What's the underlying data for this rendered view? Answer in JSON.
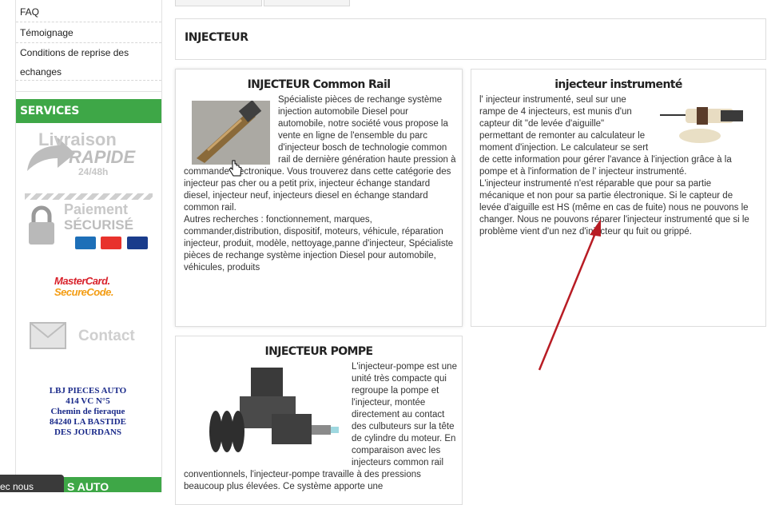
{
  "sidebar": {
    "links": [
      "FAQ",
      "Témoignage",
      "Conditions de reprise des echanges"
    ],
    "services_title": "SERVICES",
    "livraison": {
      "line1": "Livraison",
      "line2": "RAPIDE",
      "line3": "24/48h"
    },
    "paiement": {
      "line1": "Paiement",
      "line2": "SÉCURISÉ"
    },
    "mastercard": {
      "line1": "MasterCard.",
      "line2": "SecureCode."
    },
    "contact_label": "Contact",
    "address": [
      "LBJ PIECES AUTO",
      "414 VC N°5",
      "Chemin de fieraque",
      "84240 LA BASTIDE",
      "DES JOURDANS"
    ],
    "bottom_bar_text": "S AUTO",
    "toast_text": "ec nous"
  },
  "main": {
    "section_title": "INJECTEUR",
    "cards": [
      {
        "title": "INJECTEUR Common Rail",
        "text": "Spécialiste pièces de rechange système injection automobile Diesel pour automobile, notre société vous propose la vente en ligne de l'ensemble du parc d'injecteur bosch de technologie common rail de dernière génération haute pression à commande électronique. Vous trouverez dans cette catégorie des injecteur pas cher ou a petit prix, injecteur échange standard diesel, injecteur neuf, injecteurs diesel en échange standard common rail.",
        "text2": "Autres recherches : fonctionnement, marques, commander,distribution, dispositif, moteurs, véhicule, réparation injecteur, produit, modèle, nettoyage,panne d'injecteur, Spécialiste pièces de rechange système injection Diesel pour automobile, véhicules, produits"
      },
      {
        "title": "injecteur instrumenté",
        "text": "l' injecteur instrumenté, seul sur une rampe de 4 injecteurs, est munis d'un capteur dit \"de levée d'aiguille\" permettant de remonter au calculateur le moment d'injection. Le calculateur se sert de cette information pour gérer l'avance à l'injection grâce à la pompe et à l'information de l' injecteur instrumenté.",
        "text2": "L'injecteur instrumenté n'est réparable que pour sa partie mécanique et non pour sa partie électronique. Si le capteur de levée d'aiguille est HS (même en cas de fuite) nous ne pouvons le changer. Nous ne pouvons réparer l'injecteur instrumenté que si le problème vient d'un nez d'injecteur qu fuit ou grippé."
      },
      {
        "title": "INJECTEUR POMPE",
        "text": "L'injecteur-pompe est une unité très compacte qui regroupe la pompe et l'injecteur, montée directement au contact des culbuteurs sur la tête de cylindre du moteur. En comparaison avec les injecteurs common rail conventionnels, l'injecteur-pompe travaille à des pressions beaucoup plus élevées. Ce système apporte une"
      }
    ]
  },
  "colors": {
    "green": "#3ea747",
    "arrow": "#b81c24",
    "mastercard_red": "#d8212b",
    "address_blue": "#1a2a8a"
  }
}
